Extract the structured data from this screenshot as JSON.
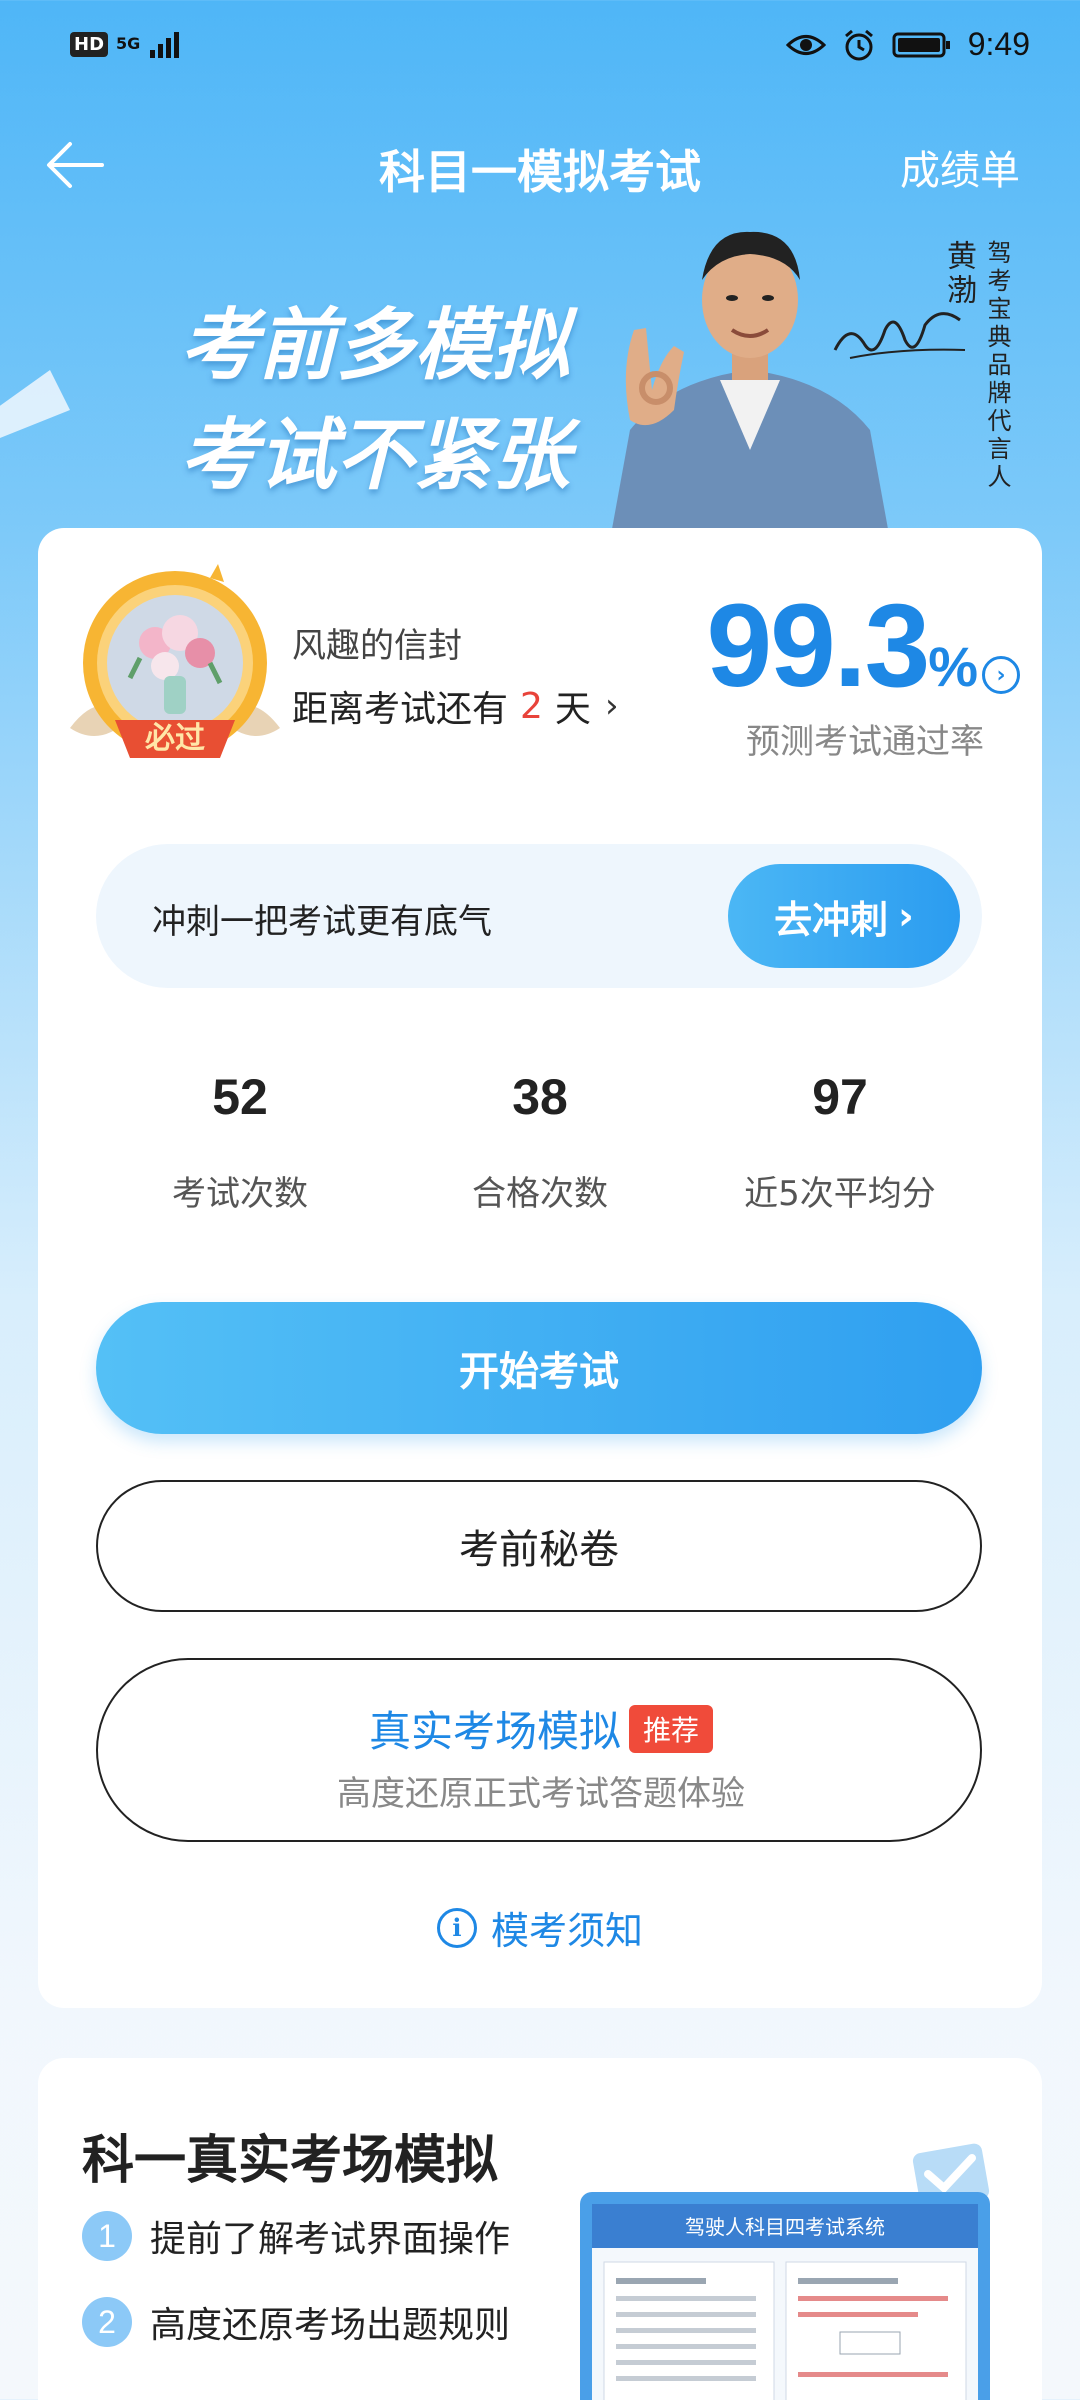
{
  "status_bar": {
    "hd": "HD",
    "network": "5G",
    "time": "9:49"
  },
  "nav": {
    "title": "科目一模拟考试",
    "right_link": "成绩单"
  },
  "banner": {
    "slogan_line1": "考前多模拟",
    "slogan_line2": "考试不紧张",
    "spokesperson_name": "黄渤",
    "spokesperson_title": "驾考宝典品牌代言人"
  },
  "profile": {
    "medal_text": "必过",
    "username": "风趣的信封",
    "countdown_prefix": "距离考试还有",
    "countdown_days": "2",
    "countdown_suffix": "天"
  },
  "pass_rate": {
    "value": "99.3",
    "unit": "%",
    "label": "预测考试通过率"
  },
  "sprint": {
    "text": "冲刺一把考试更有底气",
    "button": "去冲刺"
  },
  "stats": [
    {
      "value": "52",
      "label": "考试次数"
    },
    {
      "value": "38",
      "label": "合格次数"
    },
    {
      "value": "97",
      "label": "近5次平均分"
    }
  ],
  "actions": {
    "start": "开始考试",
    "secret": "考前秘卷",
    "sim_title": "真实考场模拟",
    "sim_tag": "推荐",
    "sim_sub": "高度还原正式考试答题体验",
    "notice": "模考须知"
  },
  "sim_card": {
    "title": "科一真实考场模拟",
    "features": [
      {
        "num": "1",
        "text": "提前了解考试界面操作"
      },
      {
        "num": "2",
        "text": "高度还原考场出题规则"
      }
    ],
    "preview_header": "驾驶人科目四考试系统"
  },
  "colors": {
    "accent": "#1e88e5",
    "button_gradient_start": "#54c0f6",
    "button_gradient_end": "#2f9ff0",
    "danger": "#e8433a"
  }
}
